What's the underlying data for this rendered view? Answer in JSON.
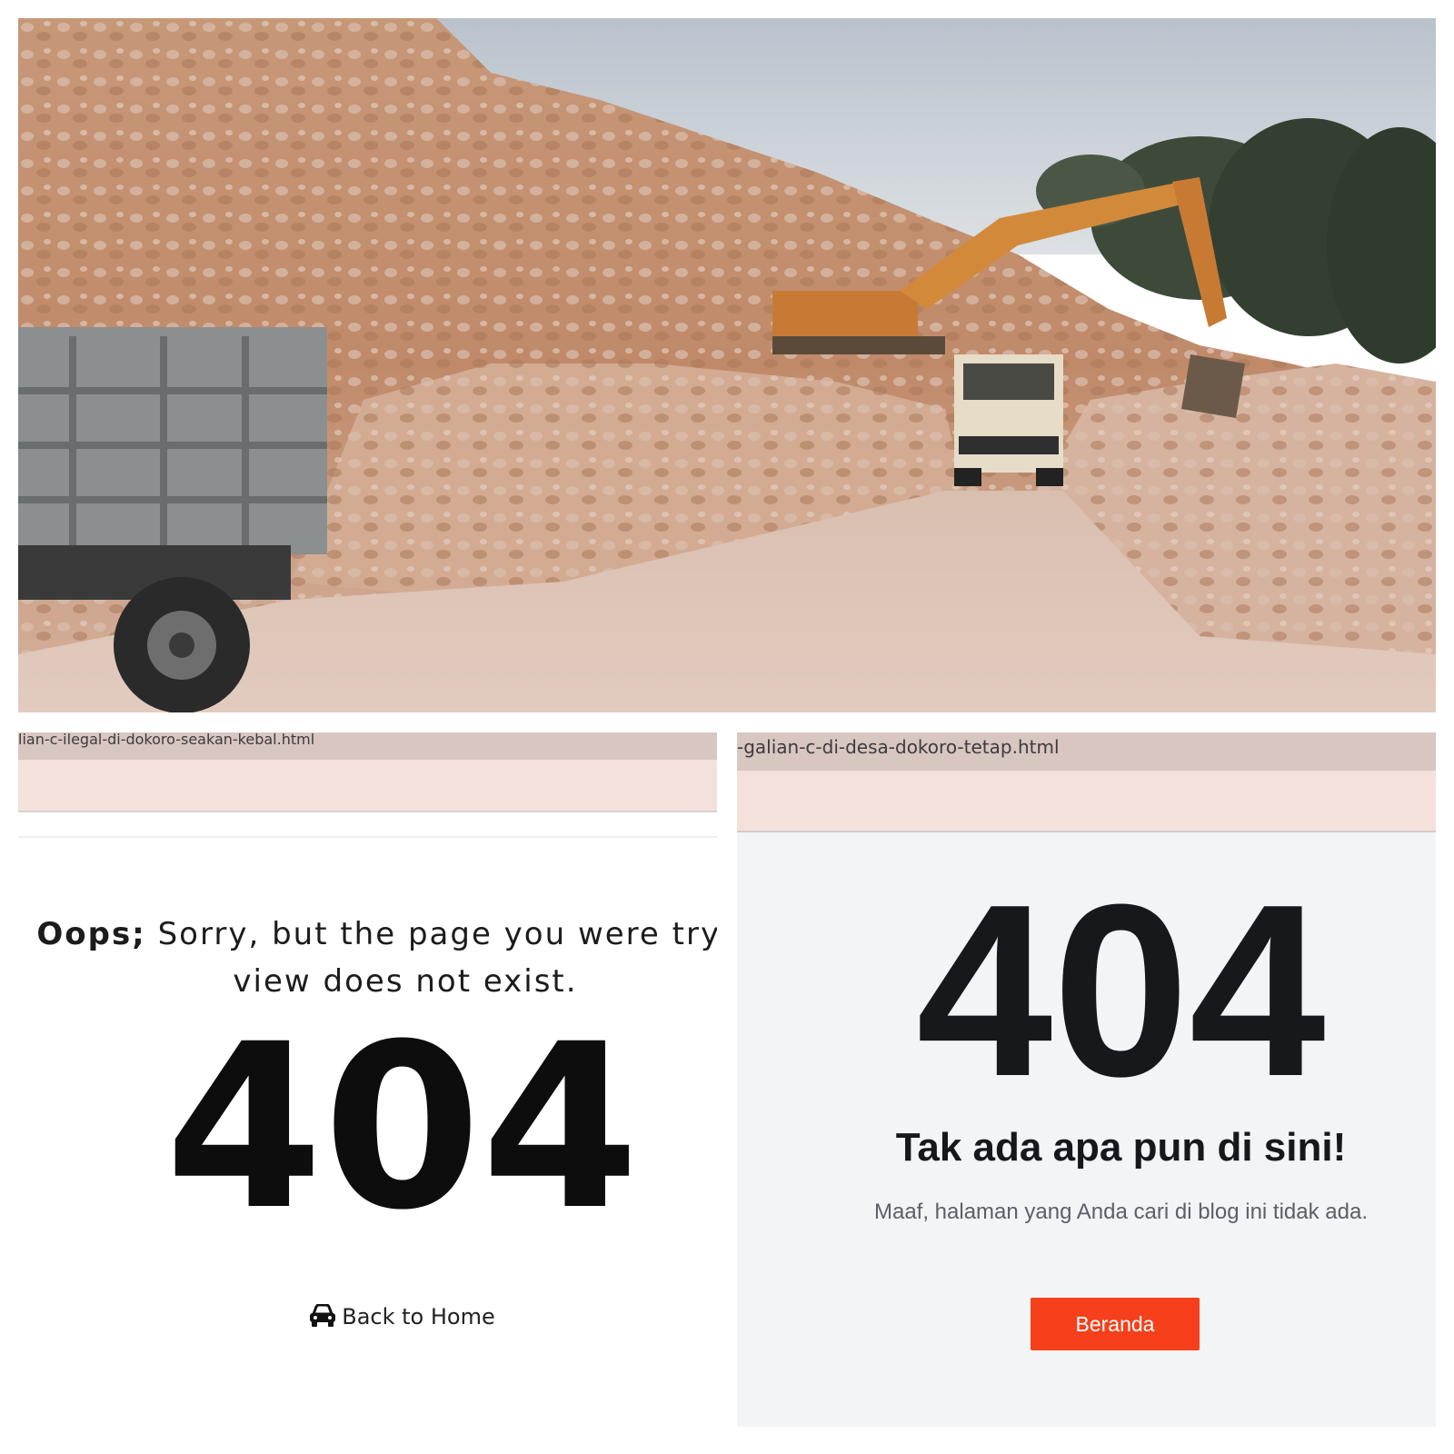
{
  "photo": {
    "description_icon": "quarry-photo-icon"
  },
  "left_panel": {
    "url_fragment": "lian-c-ilegal-di-dokoro-seakan-kebal.html",
    "oops_prefix": "Oops;",
    "oops_text": " Sorry, but the page you were trying view does not exist.",
    "code": "404",
    "back_label": "Back to Home",
    "back_icon": "car-icon"
  },
  "right_panel": {
    "url_fragment": "-galian-c-di-desa-dokoro-tetap.html",
    "code": "404",
    "heading": "Tak ada apa pun di sini!",
    "subtext": "Maaf, halaman yang Anda cari di blog ini tidak ada.",
    "button_label": "Beranda",
    "button_color": "#f5401b"
  }
}
